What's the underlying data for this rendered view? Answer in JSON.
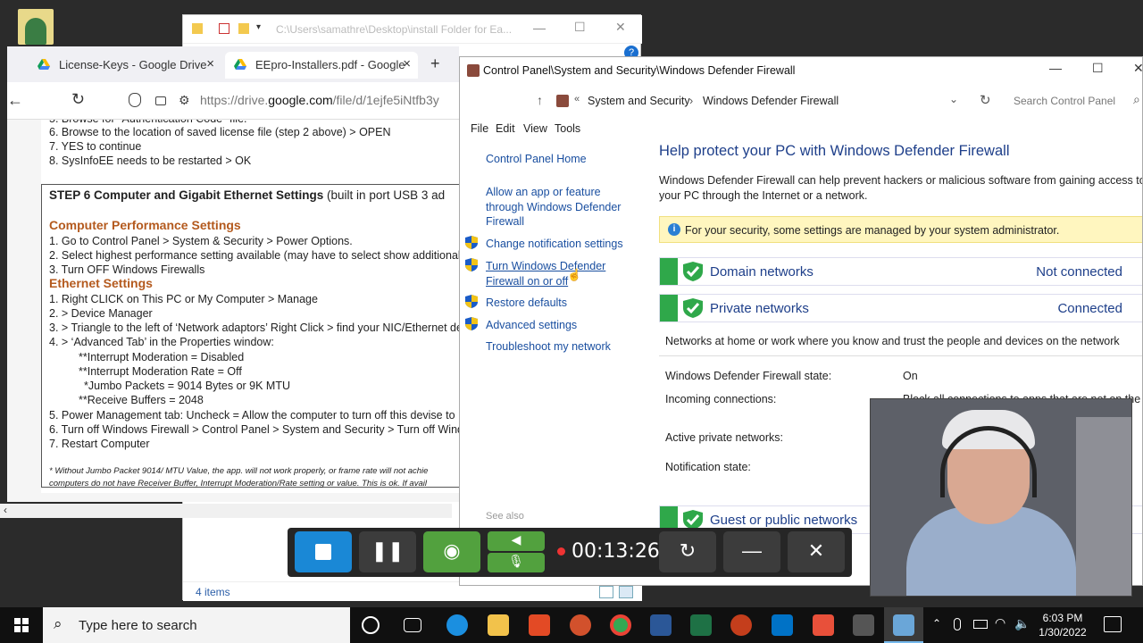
{
  "explorer": {
    "path": "C:\\Users\\samathre\\Desktop\\install Folder for Ea...",
    "status_items": "4 items"
  },
  "browser": {
    "tabs": [
      {
        "label": "License-Keys - Google Drive"
      },
      {
        "label": "EEpro-Installers.pdf - Google"
      }
    ],
    "url_prefix": "https://drive.",
    "url_domain": "google.com",
    "url_suffix": "/file/d/1ejfe5iNtfb3y",
    "doc_lines_top": [
      "6. Browse to the location of saved license file (step 2 above)  > OPEN",
      "7. YES to continue",
      "8. SysInfoEE needs to be restarted > OK"
    ],
    "step6_title": "STEP 6     Computer and Gigabit Ethernet Settings",
    "step6_note": " (built in port USB 3 ad",
    "perf_heading": "Computer Performance Settings",
    "perf_lines": [
      "1. Go to Control Panel > System & Security > Power Options.",
      "2. Select highest performance setting available (may have to select show additional",
      "3. Turn OFF Windows Firewalls"
    ],
    "eth_heading": "Ethernet Settings",
    "eth_lines": [
      "1. Right CLICK on This PC or My Computer > Manage",
      "2. > Device Manager",
      "3. > Triangle to the left of ‘Network adaptors’ Right Click > find your NIC/Ethernet de",
      "4. > ‘Advanced Tab’ in the Properties window:"
    ],
    "eth_sub": [
      "**Interrupt Moderation = Disabled",
      "**Interrupt Moderation Rate = Off",
      " *Jumbo Packets = 9014 Bytes or 9K MTU",
      "**Receive Buffers = 2048"
    ],
    "eth_lines2": [
      "5. Power Management tab: Uncheck = Allow the computer to turn off this devise to",
      "6. Turn off Windows Firewall > Control Panel > System and Security > Turn off Wind",
      "7. Restart Computer"
    ],
    "foot1": "* Without Jumbo Packet 9014/ MTU Value, the app. will not work properly, or frame rate will not achie",
    "foot2": "computers do not have Receiver Buffer, Interrupt Moderation/Rate setting or value.  This is ok.  If avail"
  },
  "control_panel": {
    "title": "Control Panel\\System and Security\\Windows Defender Firewall",
    "breadcrumb": [
      "System and Security",
      "Windows Defender Firewall"
    ],
    "search_placeholder": "Search Control Panel",
    "menu": [
      "File",
      "Edit",
      "View",
      "Tools"
    ],
    "sidebar": {
      "home": "Control Panel Home",
      "allow_app": "Allow an app or feature through Windows Defender Firewall",
      "change_notif": "Change notification settings",
      "turn_on_off": "Turn Windows Defender Firewall on or off",
      "restore": "Restore defaults",
      "advanced": "Advanced settings",
      "troubleshoot": "Troubleshoot my network",
      "see_also": "See also"
    },
    "heading": "Help protect your PC with Windows Defender Firewall",
    "description": "Windows Defender Firewall can help prevent hackers or malicious software from gaining access to your PC through the Internet or a network.",
    "banner": "For your security, some settings are managed by your system administrator.",
    "networks": [
      {
        "name": "Domain networks",
        "status": "Not connected"
      },
      {
        "name": "Private networks",
        "status": "Connected"
      },
      {
        "name": "Guest or public networks",
        "status": ""
      }
    ],
    "private_desc": "Networks at home or work where you know and trust the people and devices on the network",
    "details": {
      "state_label": "Windows Defender Firewall state:",
      "state_value": "On",
      "incoming_label": "Incoming connections:",
      "incoming_value": "Block all connections to apps that are not on the",
      "active_label": "Active private networks:",
      "notif_label": "Notification state:"
    }
  },
  "recorder": {
    "time": "00:13:26"
  },
  "taskbar": {
    "search_placeholder": "Type here to search",
    "time": "6:03 PM",
    "date": "1/30/2022"
  },
  "colors": {
    "accent_blue": "#1a88d6",
    "recorder_green": "#52a13e",
    "firewall_green": "#2fa84a",
    "cp_link": "#1a4fa0"
  }
}
